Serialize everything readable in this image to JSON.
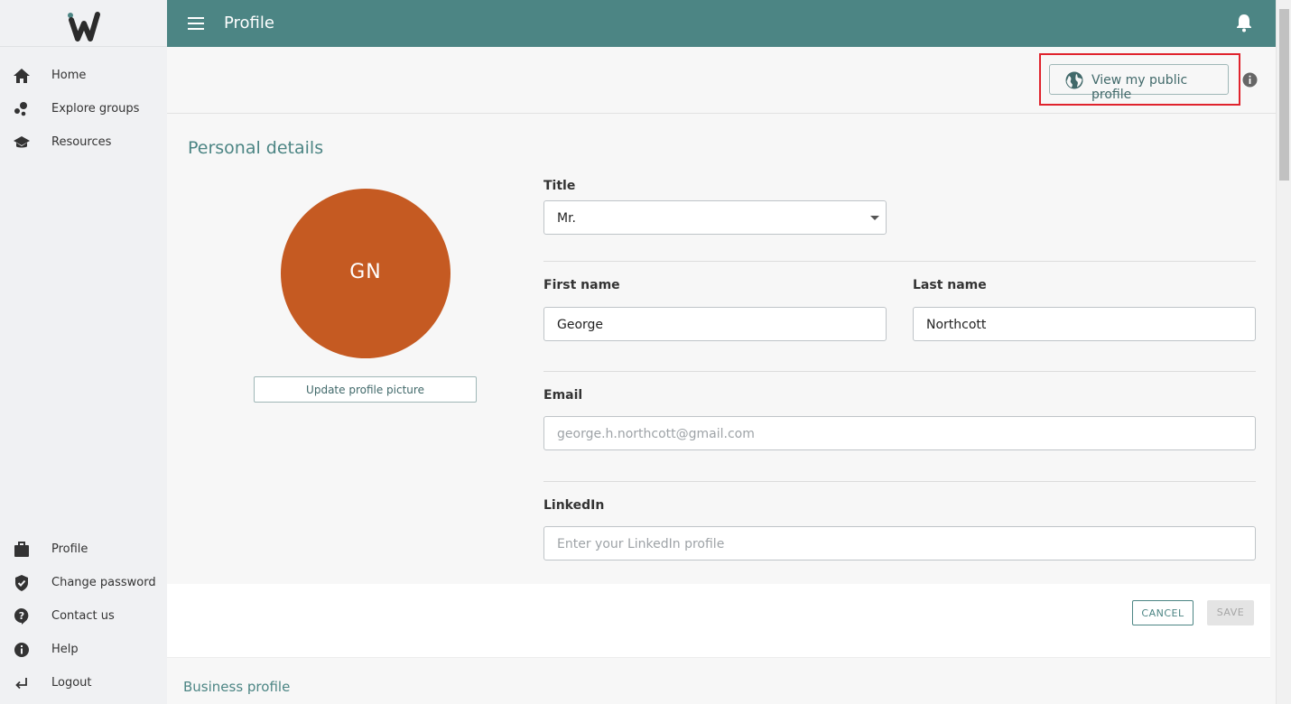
{
  "app": {
    "logo_letter": "w"
  },
  "header": {
    "title": "Profile",
    "menu_icon": "hamburger-menu-icon",
    "bell_icon": "bell-icon"
  },
  "sidebar": {
    "top_items": [
      {
        "label": "Home",
        "icon": "home-icon"
      },
      {
        "label": "Explore groups",
        "icon": "groups-icon"
      },
      {
        "label": "Resources",
        "icon": "graduation-cap-icon"
      }
    ],
    "bottom_items": [
      {
        "label": "Profile",
        "icon": "briefcase-icon"
      },
      {
        "label": "Change password",
        "icon": "shield-icon"
      },
      {
        "label": "Contact us",
        "icon": "question-icon"
      },
      {
        "label": "Help",
        "icon": "info-icon"
      },
      {
        "label": "Logout",
        "icon": "logout-arrow-icon"
      }
    ]
  },
  "actions": {
    "public_profile_label": "View my public profile"
  },
  "personal": {
    "section_title": "Personal details",
    "avatar_initials": "GN",
    "update_picture_label": "Update profile picture",
    "title_label": "Title",
    "title_value": "Mr.",
    "first_name_label": "First name",
    "first_name_value": "George",
    "last_name_label": "Last name",
    "last_name_value": "Northcott",
    "email_label": "Email",
    "email_placeholder": "george.h.northcott@gmail.com",
    "linkedin_label": "LinkedIn",
    "linkedin_placeholder": "Enter your LinkedIn profile"
  },
  "form_actions": {
    "cancel_label": "CANCEL",
    "save_label": "SAVE"
  },
  "business": {
    "section_title": "Business profile"
  },
  "colors": {
    "header_teal": "#4c8584",
    "avatar_orange": "#c55a22",
    "highlight_red": "#e0232d"
  }
}
